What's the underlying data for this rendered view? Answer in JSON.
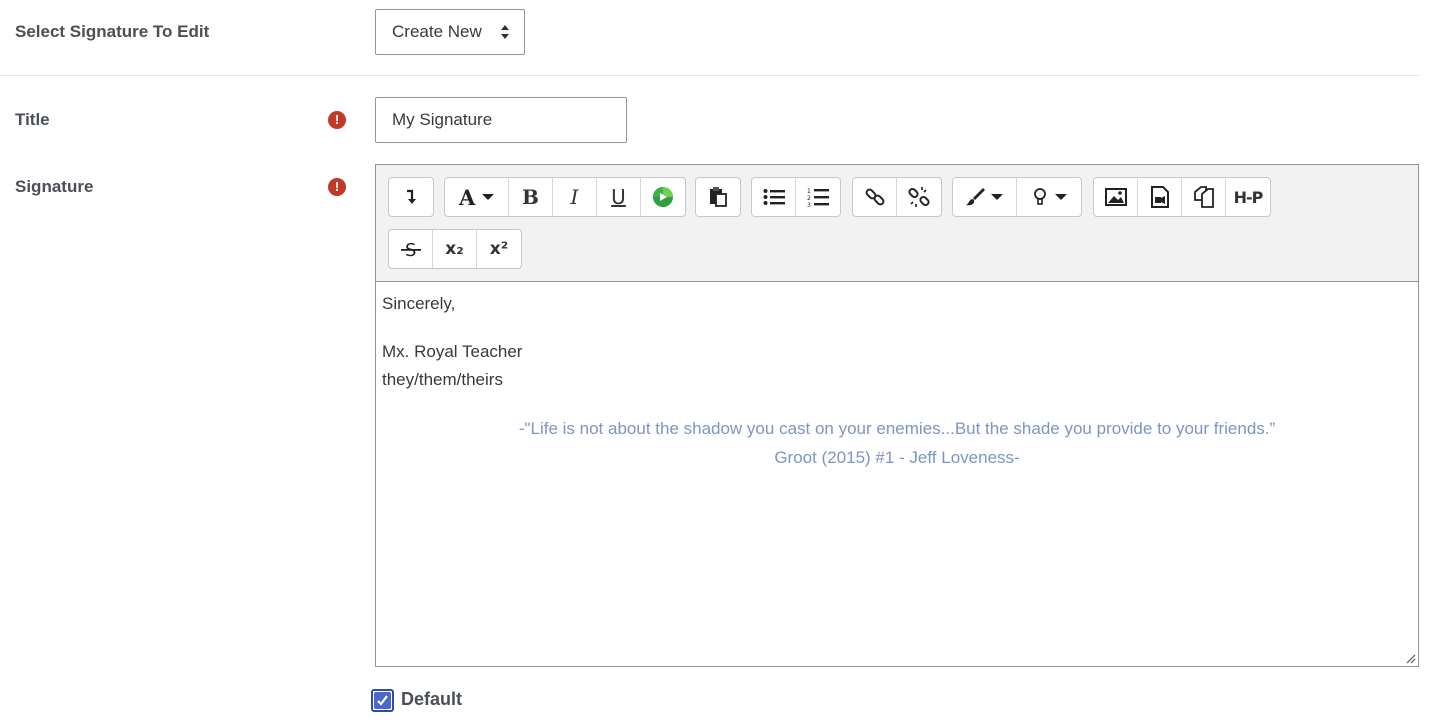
{
  "select_signature": {
    "label": "Select Signature To Edit",
    "value": "Create New"
  },
  "title_field": {
    "label": "Title",
    "value": "My Signature",
    "required_icon": "exclamation-circle-icon"
  },
  "signature_field": {
    "label": "Signature",
    "required_icon": "exclamation-circle-icon",
    "toolbar_icons": [
      "collapse-toolbar-icon",
      "font-family-icon",
      "bold-icon",
      "italic-icon",
      "underline-icon",
      "record-rtc-icon",
      "paste-icon",
      "bullet-list-icon",
      "numbered-list-icon",
      "link-icon",
      "unlink-icon",
      "text-color-icon",
      "highlight-icon",
      "image-icon",
      "media-icon",
      "manage-files-icon",
      "h5p-icon",
      "strikethrough-icon",
      "subscript-icon",
      "superscript-icon"
    ],
    "toolbar_labels": {
      "bold": "B",
      "italic": "I",
      "underline": "U",
      "h5p": "H-P",
      "subscript": "x₂",
      "superscript": "x²"
    },
    "content": {
      "line1": "Sincerely,",
      "line2": "Mx. Royal Teacher",
      "line3": "they/them/theirs",
      "quote1": "-\"Life is not about the shadow you cast on your enemies...But the shade you provide to your friends.”",
      "quote2": "Groot (2015) #1 - Jeff Loveness-"
    },
    "quote_color": "#7d95c2"
  },
  "default_checkbox": {
    "label": "Default",
    "checked": true
  },
  "colors": {
    "required": "#c0392b",
    "checkbox": "#4a67c9"
  }
}
